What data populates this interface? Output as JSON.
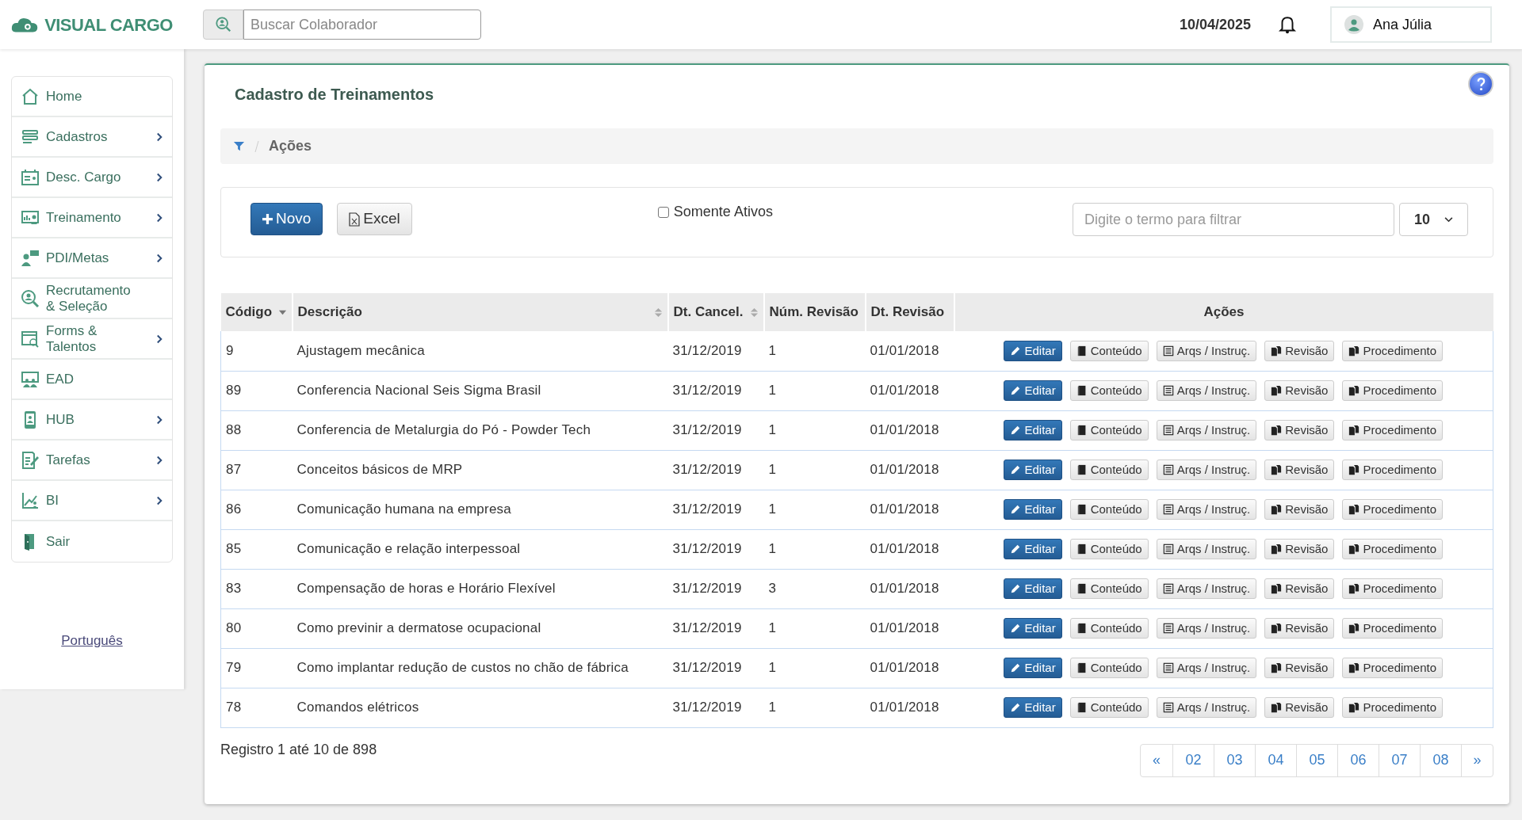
{
  "header": {
    "logo": "VISUAL CARGO",
    "search": {
      "placeholder": "Buscar Colaborador"
    },
    "date": "10/04/2025",
    "user": "Ana Júlia"
  },
  "sidebar": {
    "items": [
      {
        "label": "Home",
        "submenu": false
      },
      {
        "label": "Cadastros",
        "submenu": true
      },
      {
        "label": "Desc. Cargo",
        "submenu": true
      },
      {
        "label": "Treinamento",
        "submenu": true
      },
      {
        "label": "PDI/Metas",
        "submenu": true
      },
      {
        "label": "Recrutamento & Seleção",
        "submenu": false
      },
      {
        "label": "Forms & Talentos",
        "submenu": true
      },
      {
        "label": "EAD",
        "submenu": false
      },
      {
        "label": "HUB",
        "submenu": true
      },
      {
        "label": "Tarefas",
        "submenu": true
      },
      {
        "label": "BI",
        "submenu": true
      },
      {
        "label": "Sair",
        "submenu": false
      }
    ],
    "language": "Português"
  },
  "page": {
    "title": "Cadastro de Treinamentos",
    "breadcrumb": "Ações",
    "toolbar": {
      "new_button": "Novo",
      "excel_button": "Excel",
      "only_active": {
        "label": "Somente Ativos",
        "checked": false
      },
      "filter": {
        "placeholder": "Digite o termo para filtrar"
      },
      "page_size": "10"
    },
    "table": {
      "columns": [
        {
          "label": "Código",
          "sortable": true,
          "sorted": true
        },
        {
          "label": "Descrição",
          "sortable": true,
          "sorted": false
        },
        {
          "label": "Dt. Cancel.",
          "sortable": true,
          "sorted": false
        },
        {
          "label": "Núm. Revisão",
          "sortable": false,
          "sorted": false
        },
        {
          "label": "Dt. Revisão",
          "sortable": false,
          "sorted": false
        },
        {
          "label": "Ações",
          "sortable": false,
          "sorted": false
        }
      ],
      "rows": [
        {
          "cells": [
            "9",
            "Ajustagem mecânica",
            "31/12/2019",
            "1",
            "01/01/2018"
          ],
          "actions": [
            "Editar",
            "Conteúdo",
            "Arqs / Instruç.",
            "Revisão",
            "Procedimento"
          ]
        },
        {
          "cells": [
            "89",
            "Conferencia Nacional Seis Sigma Brasil",
            "31/12/2019",
            "1",
            "01/01/2018"
          ],
          "actions": [
            "Editar",
            "Conteúdo",
            "Arqs / Instruç.",
            "Revisão",
            "Procedimento"
          ]
        },
        {
          "cells": [
            "88",
            "Conferencia de Metalurgia do Pó - Powder Tech",
            "31/12/2019",
            "1",
            "01/01/2018"
          ],
          "actions": [
            "Editar",
            "Conteúdo",
            "Arqs / Instruç.",
            "Revisão",
            "Procedimento"
          ]
        },
        {
          "cells": [
            "87",
            "Conceitos básicos de MRP",
            "31/12/2019",
            "1",
            "01/01/2018"
          ],
          "actions": [
            "Editar",
            "Conteúdo",
            "Arqs / Instruç.",
            "Revisão",
            "Procedimento"
          ]
        },
        {
          "cells": [
            "86",
            "Comunicação humana na empresa",
            "31/12/2019",
            "1",
            "01/01/2018"
          ],
          "actions": [
            "Editar",
            "Conteúdo",
            "Arqs / Instruç.",
            "Revisão",
            "Procedimento"
          ]
        },
        {
          "cells": [
            "85",
            "Comunicação e relação interpessoal",
            "31/12/2019",
            "1",
            "01/01/2018"
          ],
          "actions": [
            "Editar",
            "Conteúdo",
            "Arqs / Instruç.",
            "Revisão",
            "Procedimento"
          ]
        },
        {
          "cells": [
            "83",
            "Compensação de horas e Horário Flexível",
            "31/12/2019",
            "3",
            "01/01/2018"
          ],
          "actions": [
            "Editar",
            "Conteúdo",
            "Arqs / Instruç.",
            "Revisão",
            "Procedimento"
          ]
        },
        {
          "cells": [
            "80",
            "Como previnir a dermatose ocupacional",
            "31/12/2019",
            "1",
            "01/01/2018"
          ],
          "actions": [
            "Editar",
            "Conteúdo",
            "Arqs / Instruç.",
            "Revisão",
            "Procedimento"
          ]
        },
        {
          "cells": [
            "79",
            "Como implantar redução de custos no chão de fábrica",
            "31/12/2019",
            "1",
            "01/01/2018"
          ],
          "actions": [
            "Editar",
            "Conteúdo",
            "Arqs / Instruç.",
            "Revisão",
            "Procedimento"
          ]
        },
        {
          "cells": [
            "78",
            "Comandos elétricos",
            "31/12/2019",
            "1",
            "01/01/2018"
          ],
          "actions": [
            "Editar",
            "Conteúdo",
            "Arqs / Instruç.",
            "Revisão",
            "Procedimento"
          ]
        }
      ]
    },
    "summary": "Registro 1 até 10 de 898",
    "pagination": [
      "«",
      "02",
      "03",
      "04",
      "05",
      "06",
      "07",
      "08",
      "»"
    ]
  }
}
